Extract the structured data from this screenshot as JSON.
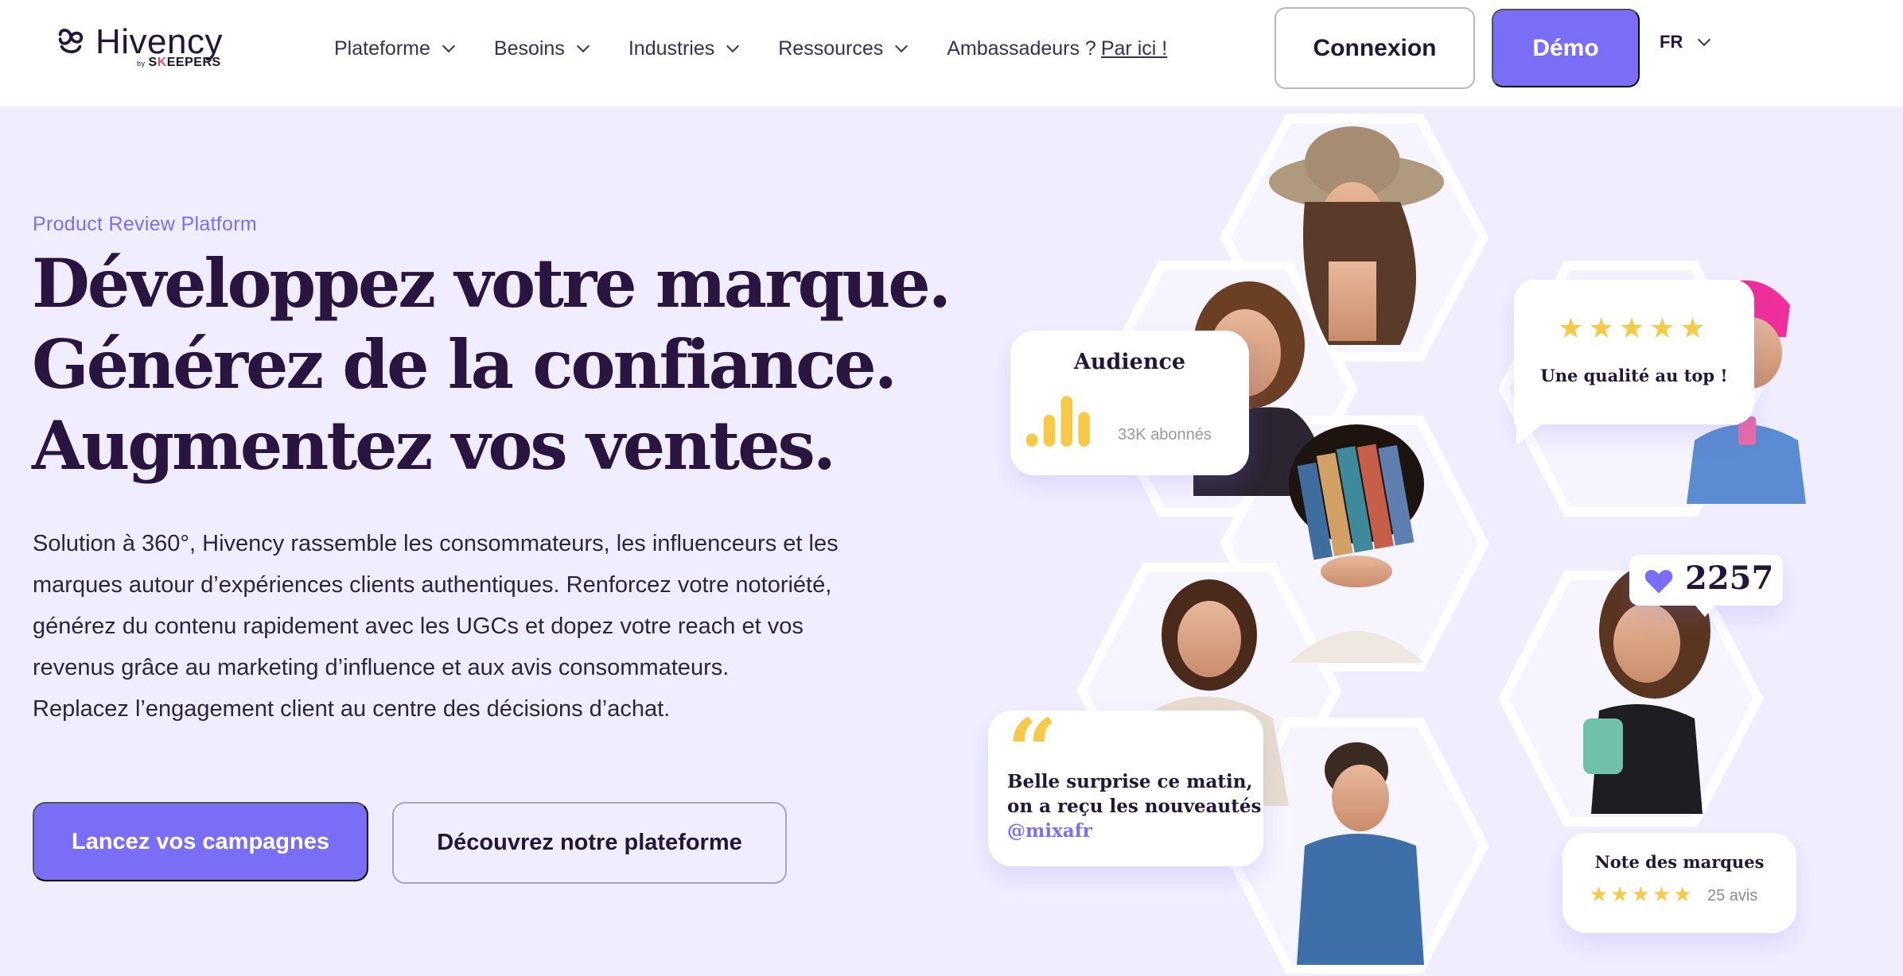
{
  "brand": {
    "name": "Hivency",
    "by": "by",
    "partner_prefix": "S",
    "partner_k": "K",
    "partner_suffix": "EEPERS"
  },
  "nav": {
    "items": [
      {
        "label": "Plateforme"
      },
      {
        "label": "Besoins"
      },
      {
        "label": "Industries"
      },
      {
        "label": "Ressources"
      }
    ],
    "ambassadors_text": "Ambassadeurs ?",
    "ambassadors_link": "Par ici !",
    "login_label": "Connexion",
    "demo_label": "Démo",
    "language": "FR"
  },
  "hero": {
    "eyebrow": "Product Review Platform",
    "headline": [
      "Développez votre marque.",
      "Générez de la confiance.",
      "Augmentez vos ventes."
    ],
    "description": "Solution à 360°, Hivency rassemble les consommateurs, les influenceurs et les marques autour d’expériences clients authentiques. Renforcez votre notoriété, générez du contenu rapidement avec les UGCs et dopez votre reach et vos revenus grâce au marketing d’influence et aux avis consommateurs.",
    "description_2": "Replacez l’engagement client au centre des décisions d’achat.",
    "cta_primary": "Lancez vos campagnes",
    "cta_secondary": "Découvrez notre plateforme"
  },
  "cards": {
    "audience": {
      "title": "Audience",
      "subtitle": "33K abonnés"
    },
    "quality": {
      "text": "Une qualité au top !",
      "stars": 5
    },
    "likes": {
      "count": "2257"
    },
    "quote": {
      "mark": "“",
      "line1": "Belle surprise ce matin,",
      "line2": "on a reçu les nouveautés",
      "handle": "@mixafr"
    },
    "rating": {
      "title": "Note des marques",
      "stars": 5,
      "count": "25 avis"
    }
  },
  "colors": {
    "accent": "#7b6ef6",
    "hero_bg": "#f0eefe",
    "heading": "#2a1540",
    "star": "#f7c948"
  },
  "icons": [
    "chevron-down-icon",
    "heart-icon",
    "star-icon",
    "quote-icon",
    "bar-chart-icon",
    "hivency-logo-icon"
  ]
}
